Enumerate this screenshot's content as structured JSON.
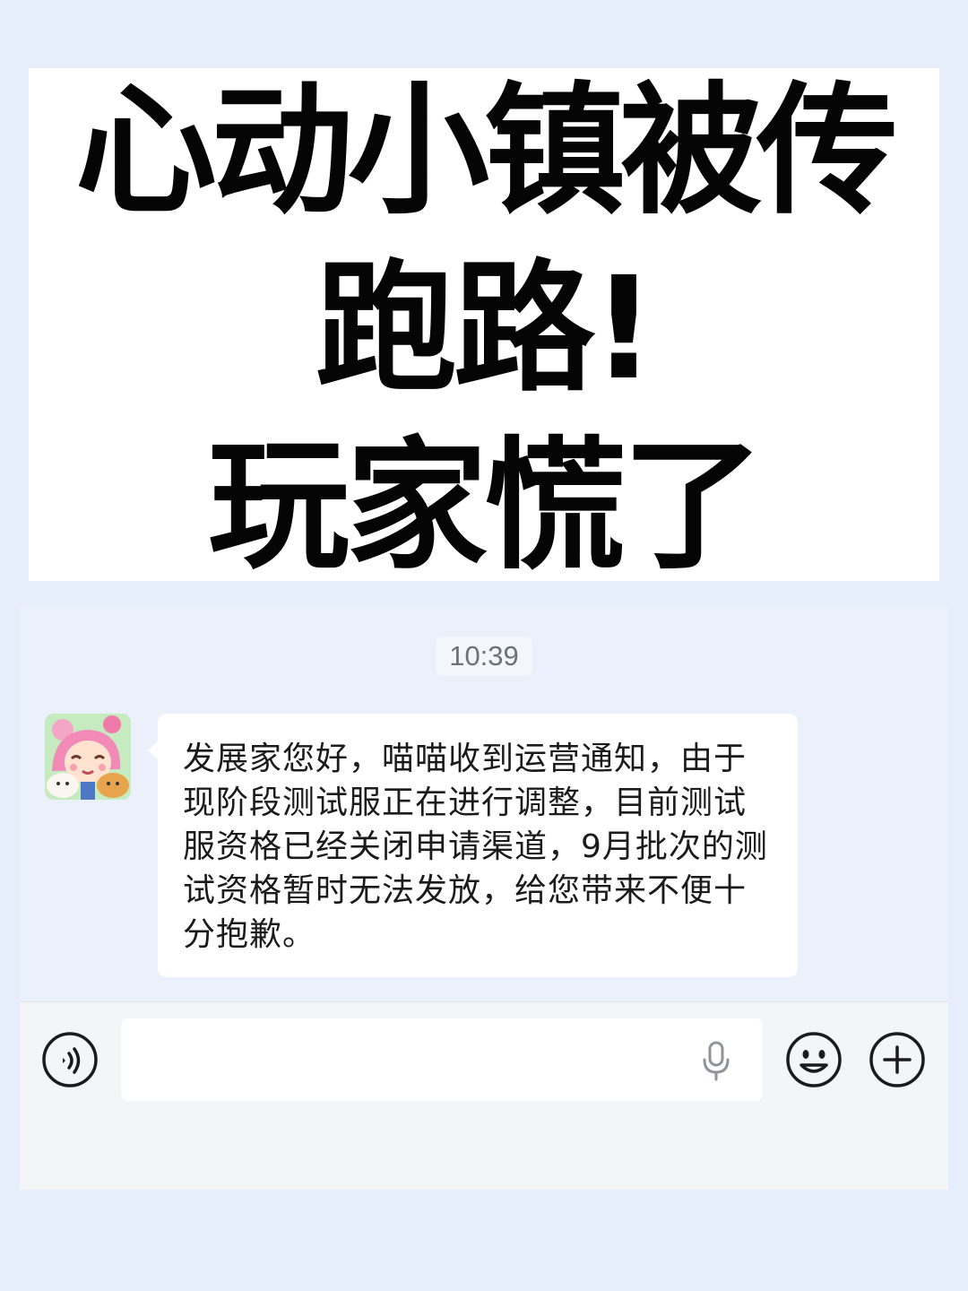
{
  "headline": {
    "line1": "心动小镇被传",
    "line2": "跑路!",
    "line3": "玩家慌了"
  },
  "chat": {
    "timestamp": "10:39",
    "message": {
      "sender_avatar_icon": "game-avatar",
      "text": "发展家您好，喵喵收到运营通知，由于现阶段测试服正在进行调整，目前测试服资格已经关闭申请渠道，9月批次的测试资格暂时无法发放，给您带来不便十分抱歉。"
    }
  },
  "input_bar": {
    "voice_icon": "voice-toggle-icon",
    "input_placeholder": "",
    "mic_icon": "microphone-icon",
    "emoji_icon": "smiley-icon",
    "plus_icon": "plus-icon"
  },
  "colors": {
    "page_background": "#e5eefa",
    "card_background": "#ffffff",
    "headline_text": "#050505",
    "bubble_background": "#ffffff",
    "input_bar_background": "#f4f5f7",
    "timestamp_text": "#6c727c"
  }
}
